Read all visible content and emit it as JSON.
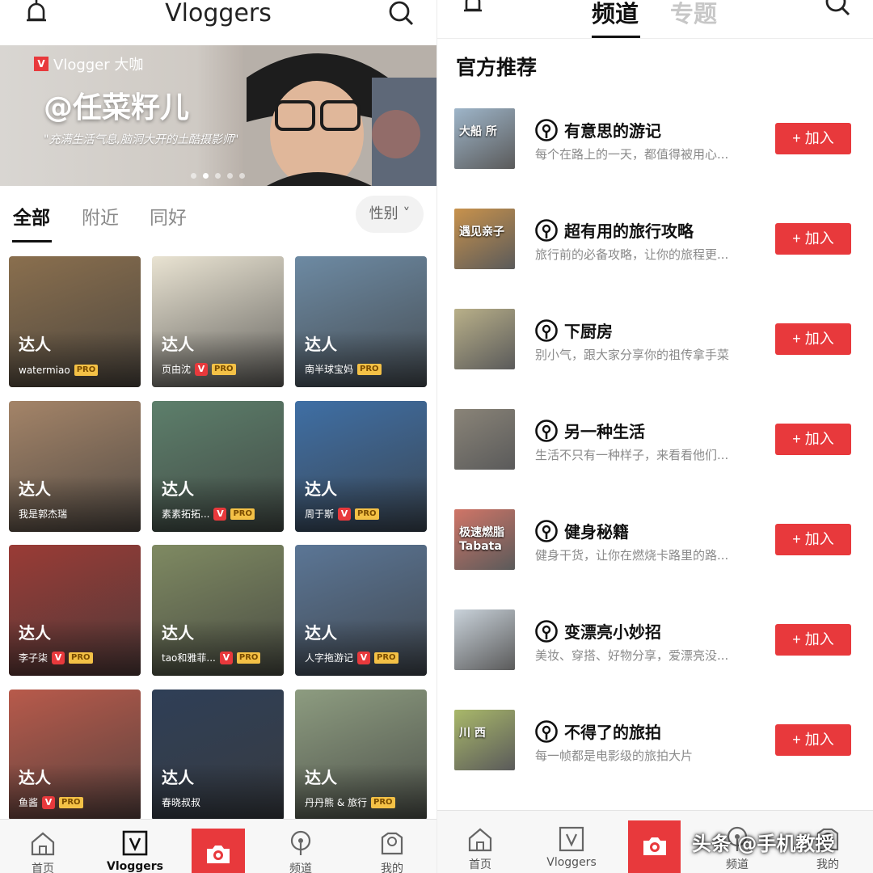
{
  "left": {
    "header": {
      "title": "Vloggers",
      "bell_icon": "bell-icon",
      "search_icon": "search-icon"
    },
    "banner": {
      "brand_label": "Vlogger 大咖",
      "badge": "V",
      "name": "@任菜籽儿",
      "slogan": "\"充满生活气息,脑洞大开的土酷摄影师\"",
      "slide_count": 5,
      "active_slide": 2
    },
    "tabs": [
      {
        "label": "全部",
        "active": true
      },
      {
        "label": "附近",
        "active": false
      },
      {
        "label": "同好",
        "active": false
      }
    ],
    "filter": {
      "label": "性别 ˅"
    },
    "cards": [
      {
        "tag": "达人",
        "name": "watermiao",
        "verified": false,
        "pro": "PRO",
        "bg": "#8a6f4e"
      },
      {
        "tag": "达人",
        "name": "页由沈",
        "verified": true,
        "pro": "PRO",
        "bg": "#e9e3d2"
      },
      {
        "tag": "达人",
        "name": "南半球宝妈",
        "verified": false,
        "pro": "PRO",
        "bg": "#6d8aa3"
      },
      {
        "tag": "达人",
        "name": "我是郭杰瑞",
        "verified": false,
        "pro": "",
        "bg": "#a48468"
      },
      {
        "tag": "达人",
        "name": "素素拓拓...",
        "verified": true,
        "pro": "PRO",
        "bg": "#5d7f6b"
      },
      {
        "tag": "达人",
        "name": "周于斯",
        "verified": true,
        "pro": "PRO",
        "bg": "#3f6fa5"
      },
      {
        "tag": "达人",
        "name": "李子柒",
        "verified": true,
        "pro": "PRO",
        "bg": "#9a3b36"
      },
      {
        "tag": "达人",
        "name": "tao和雅菲...",
        "verified": true,
        "pro": "PRO",
        "bg": "#7f8a62"
      },
      {
        "tag": "达人",
        "name": "人字拖游记",
        "verified": true,
        "pro": "PRO",
        "bg": "#5b7696"
      },
      {
        "tag": "达人",
        "name": "鱼酱",
        "verified": true,
        "pro": "PRO",
        "bg": "#b85a4b"
      },
      {
        "tag": "达人",
        "name": "春晓叔叔",
        "verified": false,
        "pro": "",
        "bg": "#2f3f57"
      },
      {
        "tag": "达人",
        "name": "丹丹熊 & 旅行",
        "verified": false,
        "pro": "PRO",
        "bg": "#8d9c80"
      }
    ],
    "nav": [
      {
        "label": "首页",
        "icon": "home-icon",
        "active": false
      },
      {
        "label": "Vloggers",
        "icon": "vloggers-icon",
        "active": true
      },
      {
        "label": "",
        "icon": "camera-icon",
        "active": false
      },
      {
        "label": "频道",
        "icon": "channel-icon",
        "active": false
      },
      {
        "label": "我的",
        "icon": "profile-icon",
        "active": false
      }
    ]
  },
  "right": {
    "tabs": [
      {
        "label": "频道",
        "active": true
      },
      {
        "label": "专题",
        "active": false
      }
    ],
    "section_title": "官方推荐",
    "join_label": "+ 加入",
    "channels": [
      {
        "title": "有意思的游记",
        "desc": "每个在路上的一天，都值得被用心...",
        "thumb_text": "大船 所",
        "bg": "#9eb5c9"
      },
      {
        "title": "超有用的旅行攻略",
        "desc": "旅行前的必备攻略，让你的旅程更...",
        "thumb_text": "遇见亲子",
        "bg": "#c8924c"
      },
      {
        "title": "下厨房",
        "desc": "别小气，跟大家分享你的祖传拿手菜",
        "thumb_text": "",
        "bg": "#b9b089"
      },
      {
        "title": "另一种生活",
        "desc": "生活不只有一种样子，来看看他们...",
        "thumb_text": "",
        "bg": "#8a8478"
      },
      {
        "title": "健身秘籍",
        "desc": "健身干货，让你在燃烧卡路里的路...",
        "thumb_text": "极速燃脂 Tabata",
        "bg": "#d07567"
      },
      {
        "title": "变漂亮小妙招",
        "desc": "美妆、穿搭、好物分享，爱漂亮没...",
        "thumb_text": "",
        "bg": "#c9d2da"
      },
      {
        "title": "不得了的旅拍",
        "desc": "每一帧都是电影级的旅拍大片",
        "thumb_text": "川 西",
        "bg": "#a9b86a"
      }
    ],
    "nav": [
      {
        "label": "首页",
        "icon": "home-icon"
      },
      {
        "label": "Vloggers",
        "icon": "vloggers-icon"
      },
      {
        "label": "",
        "icon": "camera-icon"
      },
      {
        "label": "频道",
        "icon": "channel-icon"
      },
      {
        "label": "我的",
        "icon": "profile-icon"
      }
    ],
    "watermark": "头条 @手机教授"
  }
}
